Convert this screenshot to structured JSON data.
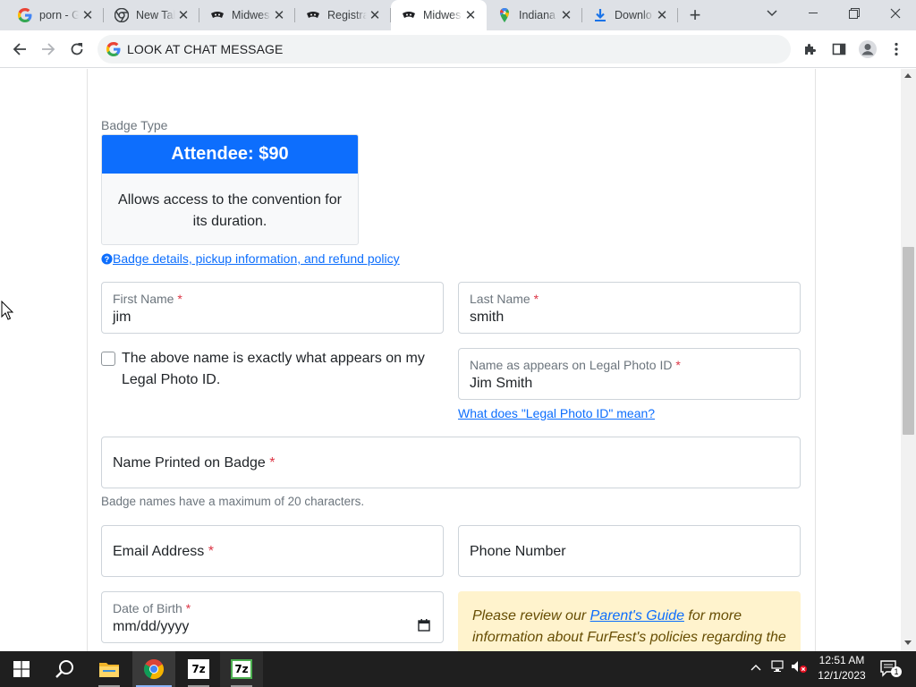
{
  "browser": {
    "tabs": [
      {
        "title": "porn - G",
        "icon": "google-icon"
      },
      {
        "title": "New Tab",
        "icon": "chrome-icon"
      },
      {
        "title": "Midwes",
        "icon": "furfest-icon"
      },
      {
        "title": "Registra",
        "icon": "furfest-icon"
      },
      {
        "title": "Midwes",
        "icon": "furfest-icon",
        "active": true
      },
      {
        "title": "Indiana",
        "icon": "maps-pin-icon"
      },
      {
        "title": "Downlo",
        "icon": "download-icon"
      }
    ],
    "address": "LOOK AT CHAT MESSAGE"
  },
  "form": {
    "badge_type_label": "Badge Type",
    "badge_title": "Attendee: $90",
    "badge_desc": "Allows access to the convention for its duration.",
    "badge_details_link": " Badge details, pickup information, and refund policy",
    "first_name": {
      "label": "First Name",
      "value": "jim"
    },
    "last_name": {
      "label": "Last Name",
      "value": "smith"
    },
    "legal_checkbox_text": "The above name is exactly what appears on my Legal Photo ID.",
    "legal_name": {
      "label": "Name as appears on Legal Photo ID",
      "value": "Jim Smith"
    },
    "legal_id_link": "What does \"Legal Photo ID\" mean?",
    "badge_name": {
      "label": "Name Printed on Badge"
    },
    "badge_name_help": "Badge names have a maximum of 20 characters.",
    "email": {
      "label": "Email Address"
    },
    "phone": {
      "label": "Phone Number"
    },
    "dob": {
      "label": "Date of Birth",
      "placeholder": "mm/dd/yyyy"
    },
    "notice_before": "Please review our ",
    "notice_link": "Parent's Guide",
    "notice_after": " for more information about FurFest's policies regarding the",
    "required_mark": "*"
  },
  "taskbar": {
    "time": "12:51 AM",
    "date": "12/1/2023",
    "notifications": "1",
    "apps": [
      "windows-start-icon",
      "search-icon",
      "file-explorer-icon",
      "chrome-icon",
      "7zip-icon",
      "7zip-icon"
    ],
    "sevenzip_label": "7z"
  },
  "colors": {
    "primary": "#0d6efd",
    "notice_bg": "#fff3cd",
    "required": "#dc3545"
  }
}
